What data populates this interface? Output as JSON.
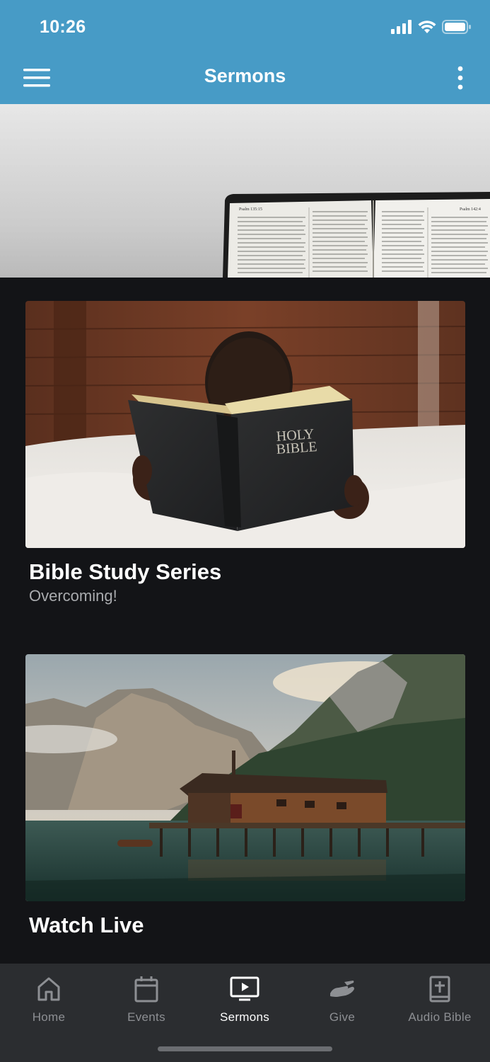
{
  "status_bar": {
    "time": "10:26"
  },
  "app_bar": {
    "title": "Sermons",
    "menu_icon": "hamburger-menu-icon",
    "more_icon": "more-vertical-icon"
  },
  "colors": {
    "accent": "#479bc6",
    "background": "#131417",
    "tabbar": "#2b2d30",
    "muted_text": "#a9abae"
  },
  "cards": [
    {
      "title": "Bible Study Series",
      "subtitle": "Overcoming!"
    },
    {
      "title": "Watch Live"
    }
  ],
  "hero_bible_text": {
    "left_header": "Psalm 135:15",
    "right_header": "Psalm 142:4"
  },
  "book_cover": {
    "line1": "HOLY",
    "line2": "BIBLE"
  },
  "tabs": [
    {
      "label": "Home",
      "icon": "home-icon",
      "active": false
    },
    {
      "label": "Events",
      "icon": "calendar-icon",
      "active": false
    },
    {
      "label": "Sermons",
      "icon": "play-video-icon",
      "active": true
    },
    {
      "label": "Give",
      "icon": "give-hand-icon",
      "active": false
    },
    {
      "label": "Audio Bible",
      "icon": "bible-book-icon",
      "active": false
    }
  ]
}
